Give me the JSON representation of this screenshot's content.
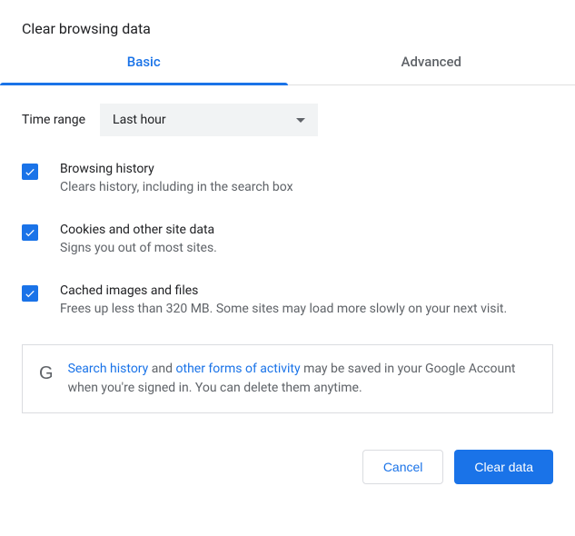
{
  "title": "Clear browsing data",
  "tabs": {
    "basic": "Basic",
    "advanced": "Advanced"
  },
  "time_range": {
    "label": "Time range",
    "value": "Last hour"
  },
  "options": {
    "browsing": {
      "title": "Browsing history",
      "desc": "Clears history, including in the search box"
    },
    "cookies": {
      "title": "Cookies and other site data",
      "desc": "Signs you out of most sites."
    },
    "cache": {
      "title": "Cached images and files",
      "desc": "Frees up less than 320 MB. Some sites may load more slowly on your next visit."
    }
  },
  "info": {
    "link1": "Search history",
    "mid1": " and ",
    "link2": "other forms of activity",
    "rest": " may be saved in your Google Account when you're signed in. You can delete them anytime."
  },
  "footer": {
    "cancel": "Cancel",
    "clear": "Clear data"
  }
}
